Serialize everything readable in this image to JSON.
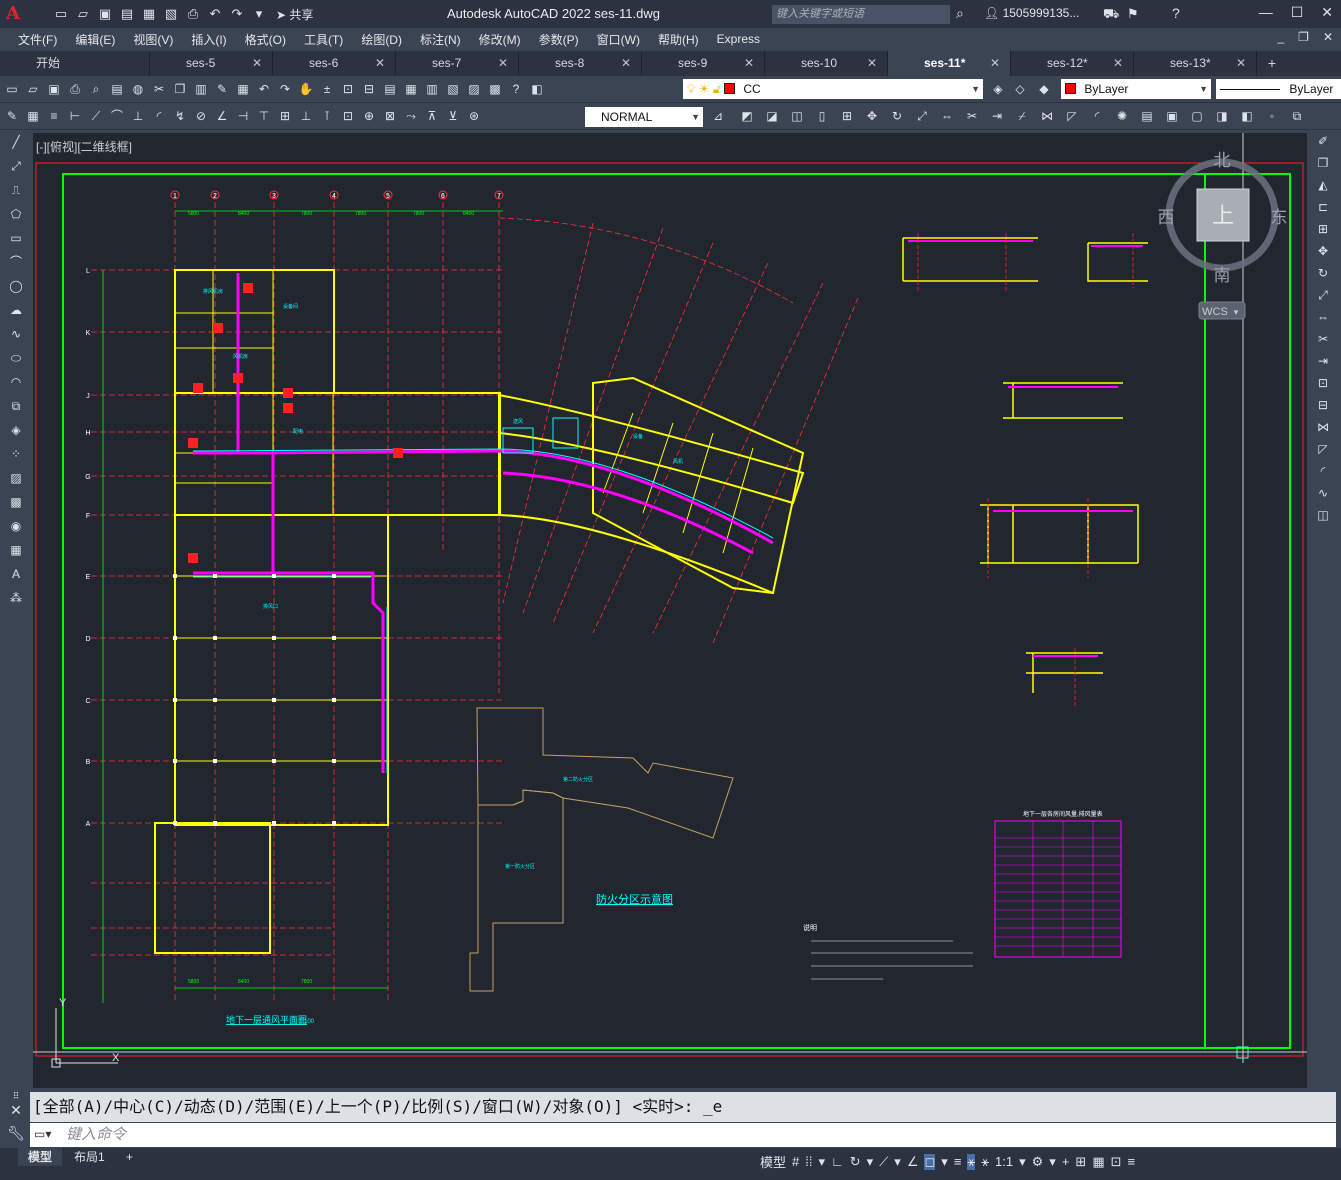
{
  "app": {
    "logo_letter": "A",
    "title": "Autodesk AutoCAD 2022    ses-11.dwg",
    "share_label": "共享",
    "search_placeholder": "键入关键字或短语",
    "user": "1505999135...",
    "window_buttons": [
      "—",
      "☐",
      "✕"
    ]
  },
  "menu": [
    "文件(F)",
    "编辑(E)",
    "视图(V)",
    "插入(I)",
    "格式(O)",
    "工具(T)",
    "绘图(D)",
    "标注(N)",
    "修改(M)",
    "参数(P)",
    "窗口(W)",
    "帮助(H)",
    "Express"
  ],
  "tabs": [
    {
      "label": "开始",
      "active": false
    },
    {
      "label": "ses-5",
      "active": false
    },
    {
      "label": "ses-6",
      "active": false
    },
    {
      "label": "ses-7",
      "active": false
    },
    {
      "label": "ses-8",
      "active": false
    },
    {
      "label": "ses-9",
      "active": false
    },
    {
      "label": "ses-10",
      "active": false
    },
    {
      "label": "ses-11*",
      "active": true
    },
    {
      "label": "ses-12*",
      "active": false
    },
    {
      "label": "ses-13*",
      "active": false
    }
  ],
  "toolbar": {
    "layer": "CC",
    "color": "ByLayer",
    "linetype": "ByLayer",
    "textstyle": "NORMAL",
    "layer_color": "#ff0000"
  },
  "viewport": {
    "label": "[-][俯视][二维线框]",
    "viewcube": {
      "north": "北",
      "south": "南",
      "east": "东",
      "west": "西",
      "top": "上",
      "wcs": "WCS"
    },
    "drawing": {
      "plan_title": "地下一层通风平面图",
      "plan_scale": "1:100",
      "fire_zone_title": "防火分区示意图",
      "zone1": "第一防火分区",
      "zone2": "第二防火分区",
      "notes_title": "说明",
      "table_title": "地下一层各房间风量,排风量表",
      "grid_numbers": [
        "1",
        "2",
        "3",
        "4",
        "5",
        "6",
        "7"
      ],
      "grid_letters": [
        "L",
        "K",
        "J",
        "H",
        "G",
        "F",
        "E",
        "D",
        "C",
        "B",
        "A"
      ]
    }
  },
  "command": {
    "history": "[全部(A)/中心(C)/动态(D)/范围(E)/上一个(P)/比例(S)/窗口(W)/对象(O)] <实时>: _e",
    "placeholder": "键入命令"
  },
  "status": {
    "layout_tabs": [
      "模型",
      "布局1"
    ],
    "model_label": "模型",
    "scale": "1:1"
  }
}
